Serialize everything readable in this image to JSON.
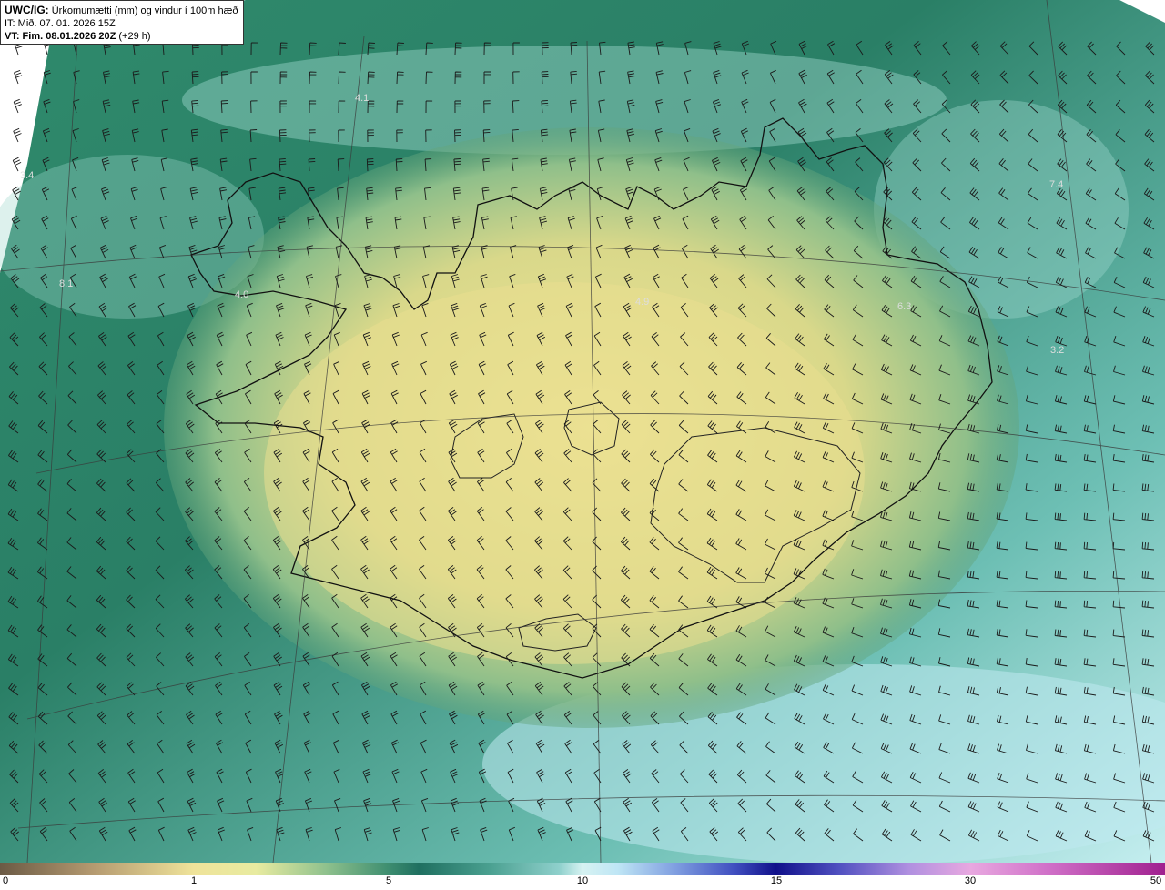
{
  "info": {
    "product_code": "UWC/IG:",
    "product_title": "Úrkomumætti (mm) og vindur í 100m hæð",
    "initial_time": "IT: Mið. 07. 01. 2026 15Z",
    "valid_time_bold": "VT: Fim. 08.01.2026 20Z",
    "valid_time_offset": "(+29 h)"
  },
  "map": {
    "station_labels": [
      "4.1",
      "3.4",
      "8.1",
      "7.4",
      "4.9",
      "6.3",
      "3.2",
      "4.0"
    ],
    "colors": {
      "ocean_deep": "#3e8e70",
      "ocean_light": "#a8dcd4",
      "land_dry": "#e9df8c",
      "coastline": "#111111",
      "barbs": "#1a1a1a"
    }
  },
  "colorbar": {
    "ticks": [
      "0",
      "1",
      "5",
      "10",
      "15",
      "30",
      "50"
    ]
  }
}
